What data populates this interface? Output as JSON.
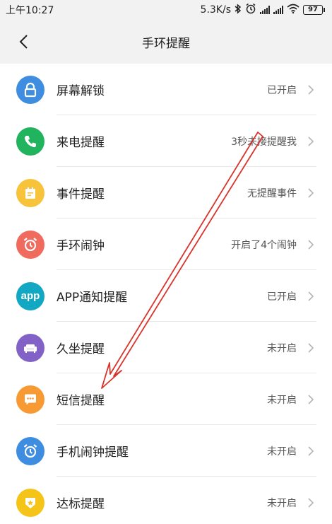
{
  "status_bar": {
    "time": "上午10:27",
    "net_speed": "5.3K/s",
    "battery": "97",
    "icons": [
      "bluetooth-icon",
      "alarm-icon",
      "signal-icon",
      "wifi-icon",
      "battery-icon"
    ]
  },
  "nav": {
    "title": "手环提醒",
    "back_icon": "chevron-left-icon"
  },
  "items": [
    {
      "label": "屏幕解锁",
      "value": "已开启",
      "icon": "lock-icon",
      "color": "#3f8de0"
    },
    {
      "label": "来电提醒",
      "value": "3秒未接提醒我",
      "icon": "phone-icon",
      "color": "#21b35e"
    },
    {
      "label": "事件提醒",
      "value": "无提醒事件",
      "icon": "calendar-icon",
      "color": "#f7c33a"
    },
    {
      "label": "手环闹钟",
      "value": "开启了4个闹钟",
      "icon": "alarm-clock-icon",
      "color": "#f06a5e"
    },
    {
      "label": "APP通知提醒",
      "value": "已开启",
      "icon": "app-icon",
      "color": "#12a7c3",
      "icon_text": "app"
    },
    {
      "label": "久坐提醒",
      "value": "未开启",
      "icon": "sofa-icon",
      "color": "#8262c6"
    },
    {
      "label": "短信提醒",
      "value": "未开启",
      "icon": "message-icon",
      "color": "#f79a33"
    },
    {
      "label": "手机闹钟提醒",
      "value": "未开启",
      "icon": "alarm-clock-icon",
      "color": "#3f8de0"
    },
    {
      "label": "达标提醒",
      "value": "未开启",
      "icon": "badge-icon",
      "color": "#f5c419"
    }
  ],
  "annotation": {
    "color": "#d9342b"
  }
}
